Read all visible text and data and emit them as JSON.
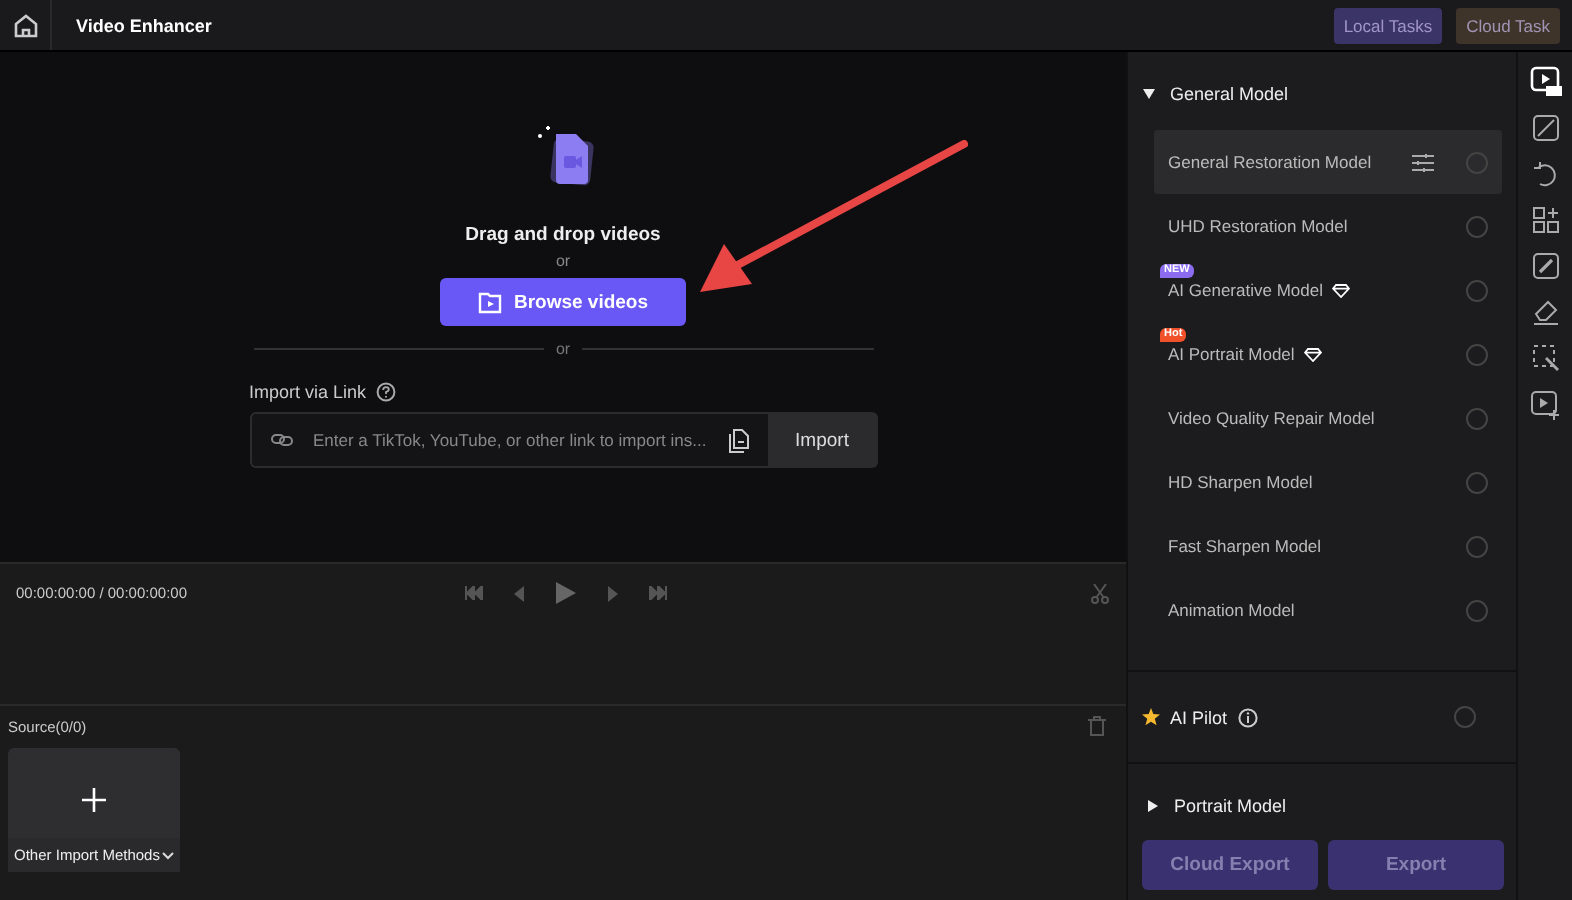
{
  "window": {
    "title": "Video Enhancer"
  },
  "task_buttons": [
    {
      "label": "Local Tasks",
      "color": "#3b3466"
    },
    {
      "label": "Cloud Task",
      "color": "#3e342a"
    }
  ],
  "dropzone": {
    "title": "Drag and drop videos",
    "or_1": "or",
    "browse_button": "Browse videos",
    "or_2": "or"
  },
  "import_link": {
    "label": "Import via Link",
    "placeholder": "Enter a TikTok, YouTube, or other link to import ins...",
    "button": "Import"
  },
  "player": {
    "timecode": "00:00:00:00 / 00:00:00:00"
  },
  "source": {
    "title": "Source(0/0)",
    "add_tile": "Other Import Methods"
  },
  "general_model": {
    "title": "General Model",
    "expanded": true,
    "models": [
      {
        "name": "General Restoration Model",
        "hovered": true,
        "checked": false
      },
      {
        "name": "UHD Restoration Model",
        "hovered": false,
        "checked": false
      },
      {
        "name": "AI Generative Model",
        "hovered": false,
        "checked": false,
        "badge": {
          "text": "NEW",
          "color": "#8b6cf0"
        },
        "premium": true
      },
      {
        "name": "AI Portrait Model",
        "hovered": false,
        "checked": false,
        "badge": {
          "text": "Hot",
          "color": "#f0502a"
        },
        "premium": true
      },
      {
        "name": "Video Quality Repair Model",
        "hovered": false,
        "checked": false
      },
      {
        "name": "HD Sharpen Model",
        "hovered": false,
        "checked": false
      },
      {
        "name": "Fast Sharpen Model",
        "hovered": false,
        "checked": false
      },
      {
        "name": "Animation Model",
        "hovered": false,
        "checked": false
      }
    ]
  },
  "ai_pilot": {
    "label": "AI Pilot",
    "checked": false
  },
  "portrait_model": {
    "title": "Portrait Model",
    "expanded": false
  },
  "export_buttons": [
    "Cloud Export",
    "Export"
  ]
}
